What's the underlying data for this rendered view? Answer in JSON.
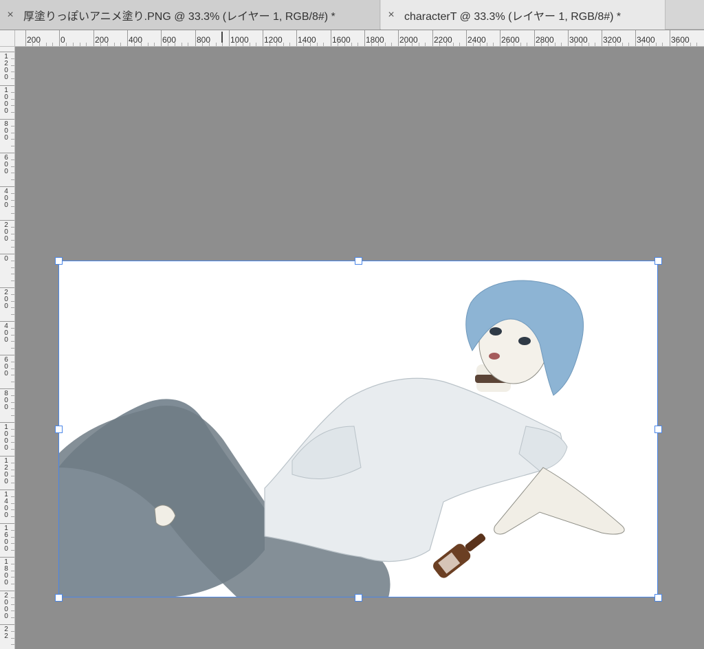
{
  "tabs": [
    {
      "label": "厚塗りっぽいアニメ塗り.PNG @ 33.3% (レイヤー 1, RGB/8#) *",
      "active": false
    },
    {
      "label": "characterT @ 33.3% (レイヤー 1, RGB/8#) *",
      "active": true
    }
  ],
  "close_glyph": "×",
  "h_ruler_labels": [
    "200",
    "0",
    "200",
    "400",
    "600",
    "800",
    "1000",
    "1200",
    "1400",
    "1600",
    "1800",
    "2000",
    "2200",
    "2400",
    "2600",
    "2800",
    "3000",
    "3200",
    "3400",
    "3600"
  ],
  "v_ruler_labels": [
    "1200",
    "1000",
    "800",
    "600",
    "400",
    "200",
    "0",
    "200",
    "400",
    "600",
    "800",
    "1000",
    "1200",
    "1400",
    "1600",
    "1800",
    "2000",
    "22"
  ],
  "colors": {
    "canvas_bg": "#8e8e8e",
    "selection": "#4a86e8",
    "hair": "#8db4d4",
    "shirt": "#e8ecef",
    "pants": "#7f8c96",
    "bottle": "#6b3f23"
  }
}
